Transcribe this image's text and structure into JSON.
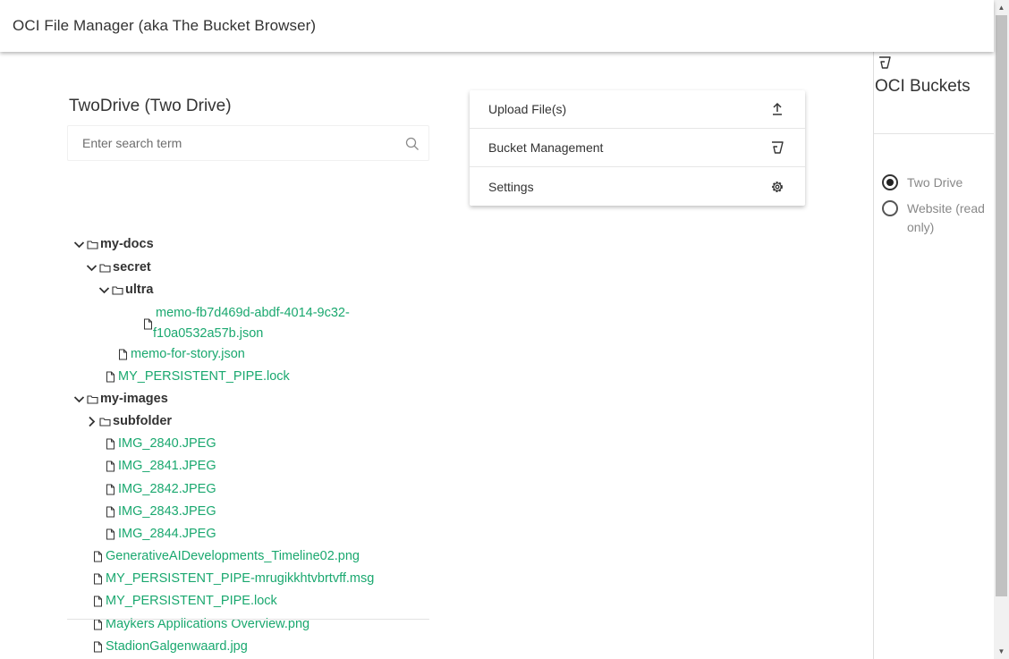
{
  "app": {
    "title": "OCI File Manager (aka The Bucket Browser)"
  },
  "bucket": {
    "title": "TwoDrive (Two Drive)"
  },
  "search": {
    "placeholder": "Enter search term"
  },
  "tree": [
    {
      "type": "folder",
      "label": "my-docs",
      "expanded": true,
      "depth": 0
    },
    {
      "type": "folder",
      "label": "secret",
      "expanded": true,
      "depth": 1
    },
    {
      "type": "folder",
      "label": "ultra",
      "expanded": true,
      "depth": 2
    },
    {
      "type": "file",
      "label": "memo-fb7d469d-abdf-4014-9c32-",
      "label2": "f10a0532a57b.json",
      "depth": 3
    },
    {
      "type": "file",
      "label": "memo-for-story.json",
      "depth": 2
    },
    {
      "type": "file",
      "label": "MY_PERSISTENT_PIPE.lock",
      "depth": 1
    },
    {
      "type": "folder",
      "label": "my-images",
      "expanded": true,
      "depth": 0
    },
    {
      "type": "folder",
      "label": "subfolder",
      "expanded": false,
      "depth": 1
    },
    {
      "type": "file",
      "label": "IMG_2840.JPEG",
      "depth": 1
    },
    {
      "type": "file",
      "label": "IMG_2841.JPEG",
      "depth": 1
    },
    {
      "type": "file",
      "label": "IMG_2842.JPEG",
      "depth": 1
    },
    {
      "type": "file",
      "label": "IMG_2843.JPEG",
      "depth": 1
    },
    {
      "type": "file",
      "label": "IMG_2844.JPEG",
      "depth": 1
    },
    {
      "type": "file",
      "label": "GenerativeAIDevelopments_Timeline02.png",
      "depth": 0
    },
    {
      "type": "file",
      "label": "MY_PERSISTENT_PIPE-mrugikkhtvbrtvff.msg",
      "depth": 0
    },
    {
      "type": "file",
      "label": "MY_PERSISTENT_PIPE.lock",
      "depth": 0
    },
    {
      "type": "file",
      "label": "Maykers Applications Overview.png",
      "depth": 0
    },
    {
      "type": "file",
      "label": "StadionGalgenwaard.jpg",
      "depth": 0
    }
  ],
  "menu": [
    {
      "label": "Upload File(s)",
      "icon": "upload-icon"
    },
    {
      "label": "Bucket Management",
      "icon": "bucket-icon"
    },
    {
      "label": "Settings",
      "icon": "gear-icon"
    }
  ],
  "sidebar": {
    "icon": "bucket-icon",
    "title": "OCI Buckets",
    "options": [
      {
        "label": "Two Drive",
        "checked": true
      },
      {
        "label": "Website (read only)",
        "checked": false
      }
    ]
  },
  "colors": {
    "file_link": "#1aa86f",
    "text": "#333333"
  }
}
